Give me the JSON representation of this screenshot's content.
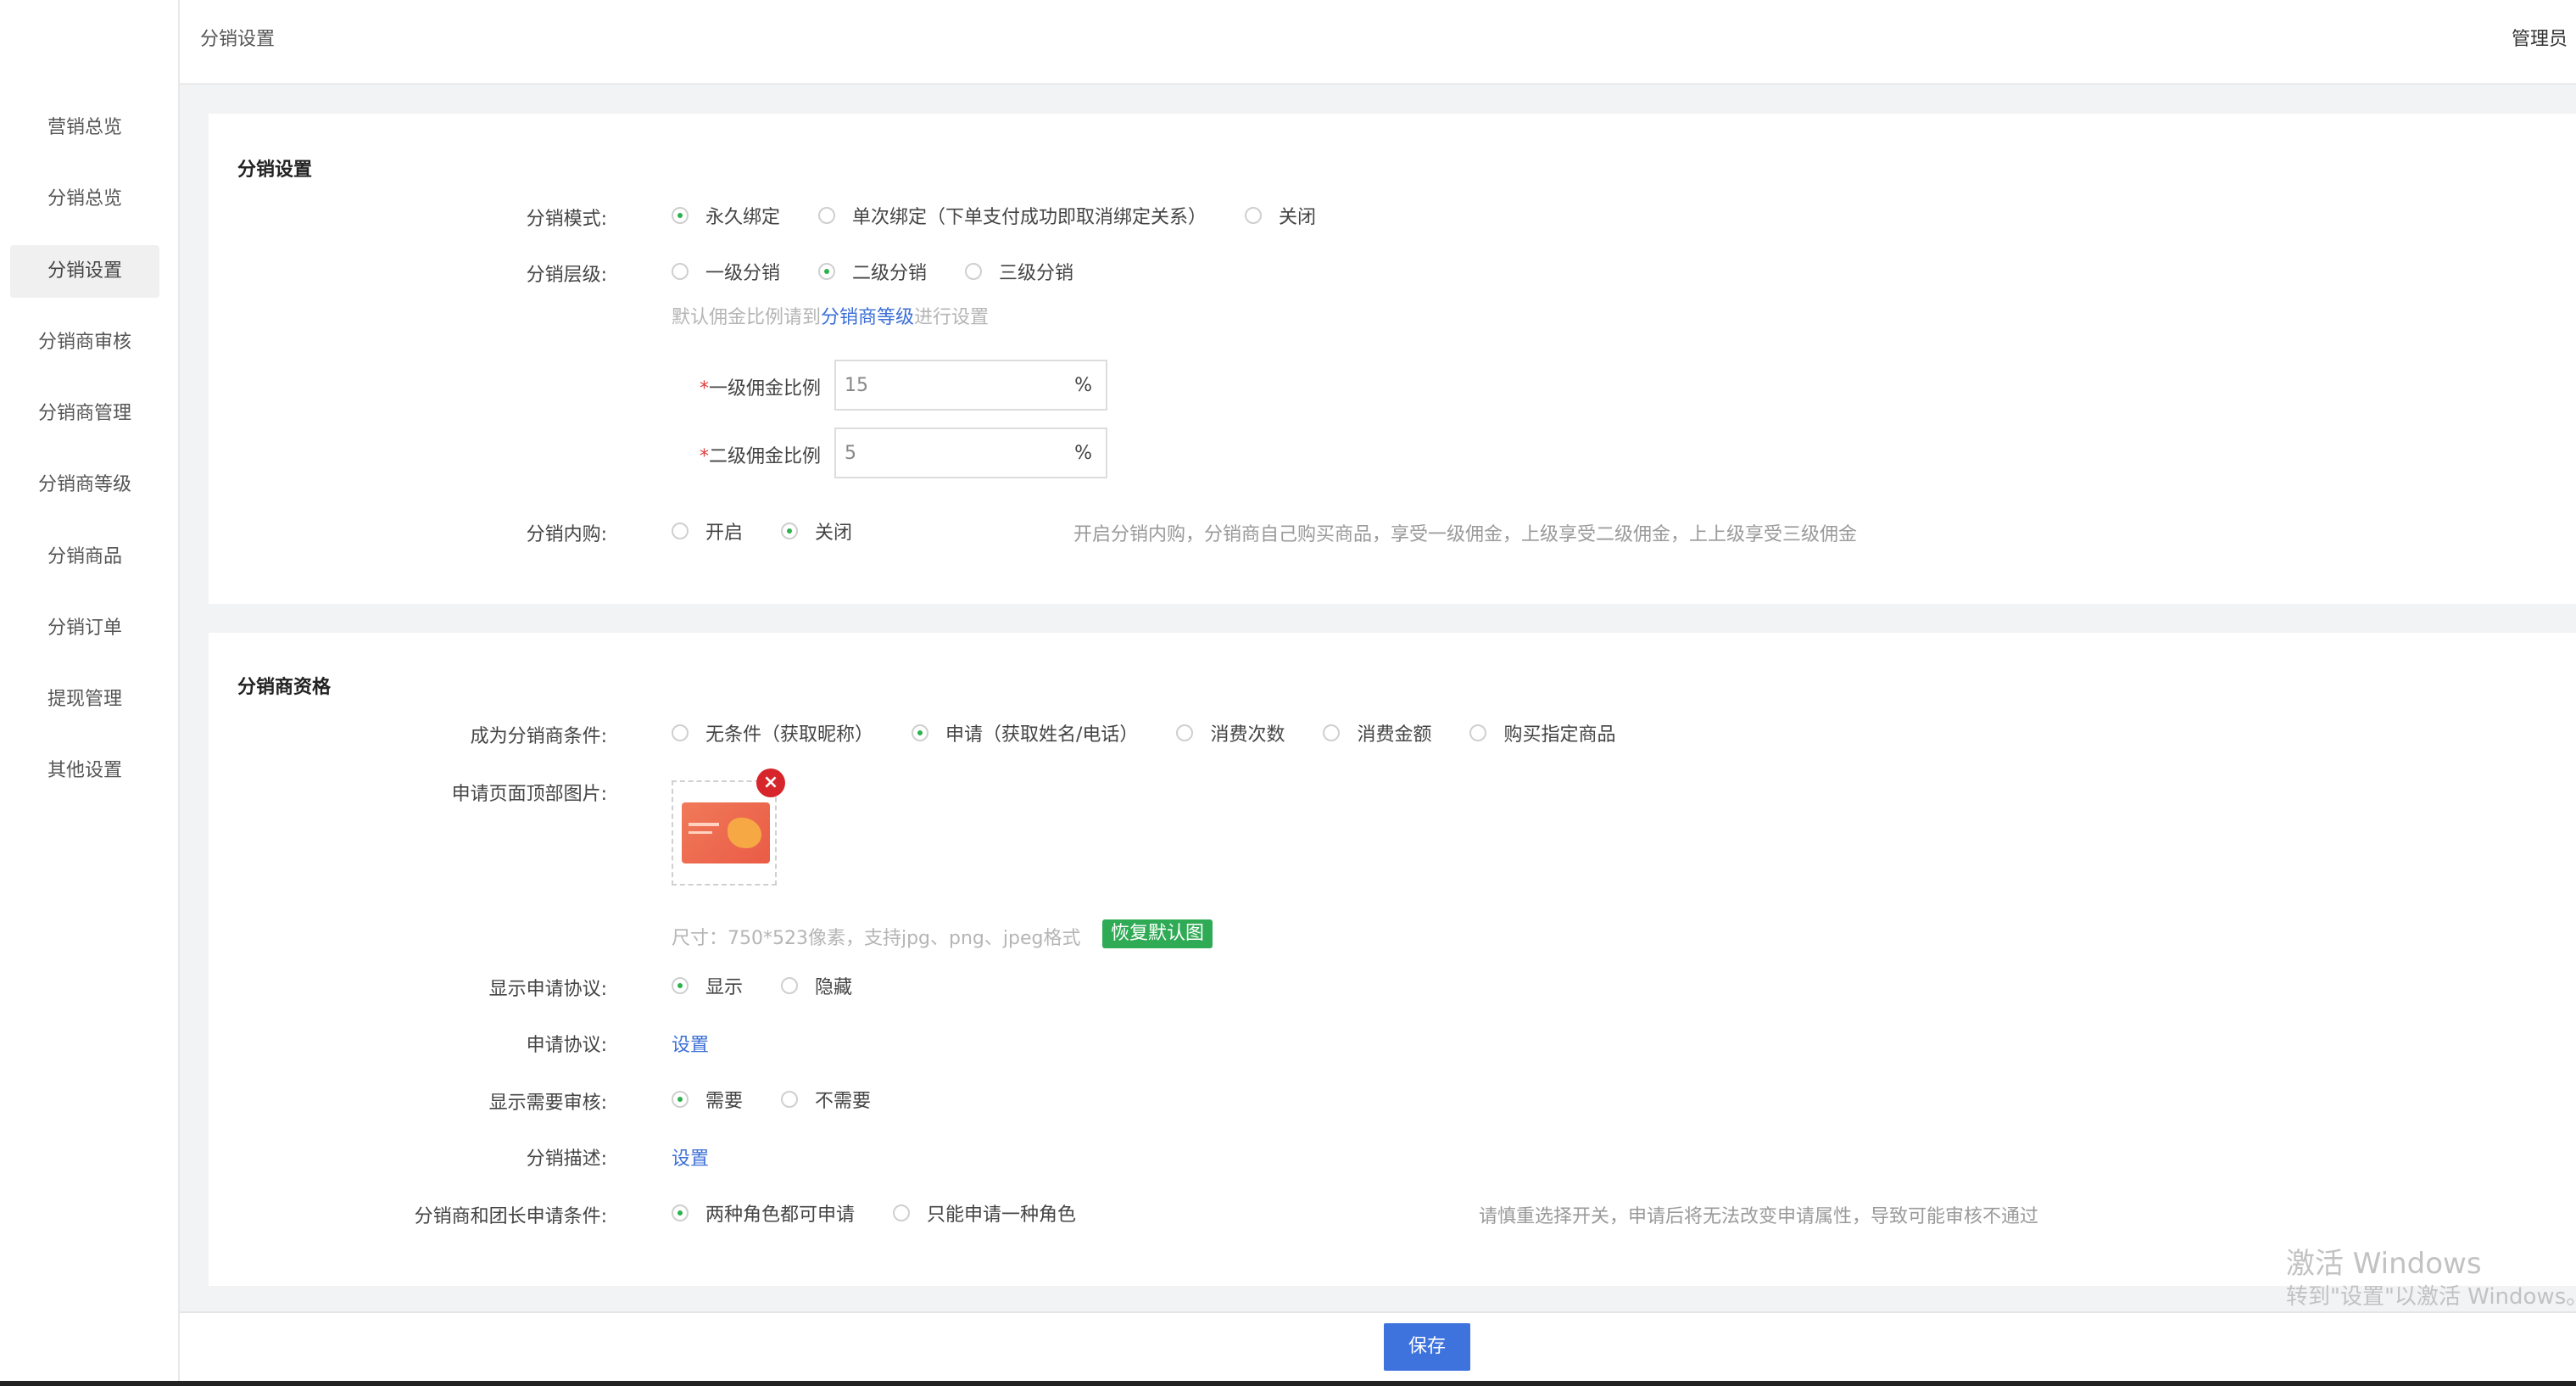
{
  "sidebar": {
    "items": [
      {
        "label": "营销总览"
      },
      {
        "label": "分销总览"
      },
      {
        "label": "分销设置"
      },
      {
        "label": "分销商审核"
      },
      {
        "label": "分销商管理"
      },
      {
        "label": "分销商等级"
      },
      {
        "label": "分销商品"
      },
      {
        "label": "分销订单"
      },
      {
        "label": "提现管理"
      },
      {
        "label": "其他设置"
      }
    ],
    "active_index": 2
  },
  "header": {
    "breadcrumb": "分销设置",
    "user": "管理员"
  },
  "distribution_settings": {
    "title": "分销设置",
    "mode": {
      "label": "分销模式:",
      "options": [
        "永久绑定",
        "单次绑定（下单支付成功即取消绑定关系）",
        "关闭"
      ],
      "selected": "永久绑定"
    },
    "level": {
      "label": "分销层级:",
      "options": [
        "一级分销",
        "二级分销",
        "三级分销"
      ],
      "selected": "二级分销",
      "hint_prefix": "默认佣金比例请到",
      "hint_link": "分销商等级",
      "hint_suffix": "进行设置"
    },
    "rate1": {
      "label": "一级佣金比例",
      "value": "15",
      "unit": "%"
    },
    "rate2": {
      "label": "二级佣金比例",
      "value": "5",
      "unit": "%"
    },
    "self_purchase": {
      "label": "分销内购:",
      "options": [
        "开启",
        "关闭"
      ],
      "selected": "关闭",
      "hint": "开启分销内购，分销商自己购买商品，享受一级佣金，上级享受二级佣金，上上级享受三级佣金"
    }
  },
  "qualification": {
    "title": "分销商资格",
    "condition": {
      "label": "成为分销商条件:",
      "options": [
        "无条件（获取昵称）",
        "申请（获取姓名/电话）",
        "消费次数",
        "消费金额",
        "购买指定商品"
      ],
      "selected": "申请（获取姓名/电话）"
    },
    "top_image": {
      "label": "申请页面顶部图片:",
      "close_glyph": "×",
      "hint": "尺寸：750*523像素，支持jpg、png、jpeg格式",
      "restore_button": "恢复默认图"
    },
    "show_agreement": {
      "label": "显示申请协议:",
      "options": [
        "显示",
        "隐藏"
      ],
      "selected": "显示"
    },
    "agreement": {
      "label": "申请协议:",
      "link": "设置"
    },
    "show_review": {
      "label": "显示需要审核:",
      "options": [
        "需要",
        "不需要"
      ],
      "selected": "需要"
    },
    "description": {
      "label": "分销描述:",
      "link": "设置"
    },
    "role_condition": {
      "label": "分销商和团长申请条件:",
      "options": [
        "两种角色都可申请",
        "只能申请一种角色"
      ],
      "selected": "两种角色都可申请",
      "hint": "请慎重选择开关，申请后将无法改变申请属性，导致可能审核不通过"
    }
  },
  "footer": {
    "save_label": "保存"
  },
  "watermark": {
    "line1": "激活 Windows",
    "line2": "转到\"设置\"以激活 Windows。"
  },
  "colors": {
    "accent_blue": "#3e72dc",
    "radio_green": "#2bb24c",
    "restore_green": "#2faa55",
    "close_red": "#d6262b"
  }
}
